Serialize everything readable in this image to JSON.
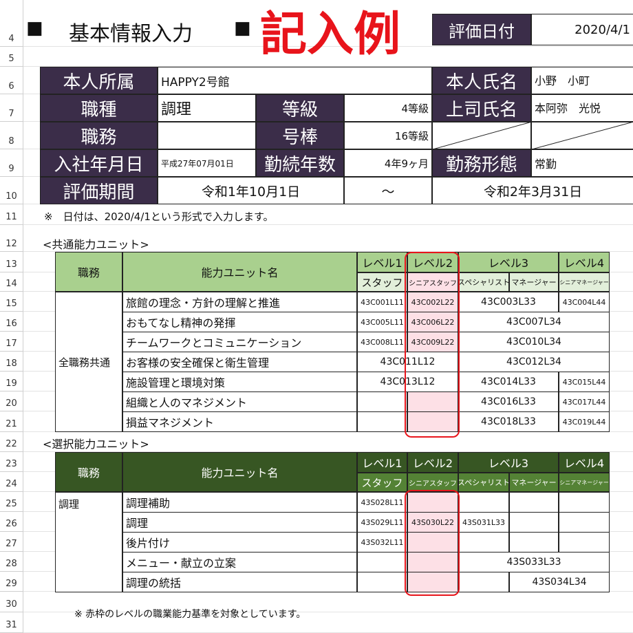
{
  "rows": [
    "4",
    "5",
    "6",
    "7",
    "8",
    "9",
    "10",
    "11",
    "12",
    "13",
    "14",
    "15",
    "16",
    "17",
    "18",
    "19",
    "20",
    "21",
    "22",
    "23",
    "24",
    "25",
    "26",
    "27",
    "28",
    "29",
    "30",
    "31"
  ],
  "heading": {
    "square1": "■",
    "title": "基本情報入力",
    "square2": "■",
    "example": "記入例"
  },
  "eval_date": {
    "label": "評価日付",
    "value": "2020/4/1"
  },
  "info": {
    "affiliation_label": "本人所属",
    "affiliation": "HAPPY2号館",
    "name_label": "本人氏名",
    "name": "小野　小町",
    "job_type_label": "職種",
    "job_type": "調理",
    "grade_label": "等級",
    "grade": "4等級",
    "boss_label": "上司氏名",
    "boss": "本阿弥　光悦",
    "duty_label": "職務",
    "duty": "",
    "number_label": "号棒",
    "number": "16等級",
    "join_label": "入社年月日",
    "join": "平成27年07月01日",
    "tenure_label": "勤続年数",
    "tenure": "4年9ヶ月",
    "work_style_label": "勤務形態",
    "work_style": "常勤",
    "period_label": "評価期間",
    "period_start": "令和1年10月1日",
    "period_sep": "～",
    "period_end": "令和2年3月31日"
  },
  "note1": "※　日付は、2020/4/1という形式で入力します。",
  "common": {
    "section": "<共通能力ユニット>",
    "col_duty": "職務",
    "col_unit": "能力ユニット名",
    "levels": [
      "レベル1",
      "レベル2",
      "レベル3",
      "レベル4"
    ],
    "roles": [
      "スタッフ",
      "シニアスタッフ",
      "スペシャリスト",
      "マネージャー",
      "シニアマネージャー"
    ],
    "group": "全職務共通",
    "units": [
      "旅館の理念・方針の理解と推進",
      "おもてなし精神の発揮",
      "チームワークとコミュニケーション",
      "お客様の安全確保と衛生管理",
      "施設管理と環境対策",
      "組織と人のマネジメント",
      "損益マネジメント"
    ],
    "codes": [
      "43C001L11",
      "43C002L22",
      "43C003L33",
      "43C004L44",
      "43C005L11",
      "43C006L22",
      "43C007L34",
      "43C008L11",
      "43C009L22",
      "43C010L34",
      "43C011L12",
      "43C012L34",
      "43C013L12",
      "43C014L33",
      "43C015L44",
      "43C016L33",
      "43C017L44",
      "43C018L33",
      "43C019L44"
    ]
  },
  "selective": {
    "section": "<選択能力ユニット>",
    "col_duty": "職務",
    "col_unit": "能力ユニット名",
    "levels": [
      "レベル1",
      "レベル2",
      "レベル3",
      "レベル4"
    ],
    "roles": [
      "スタッフ",
      "シニアスタッフ",
      "スペシャリスト",
      "マネージャー",
      "シニアマネージャー"
    ],
    "group": "調理",
    "units": [
      "調理補助",
      "調理",
      "後片付け",
      "メニュー・献立の立案",
      "調理の統括"
    ],
    "codes": [
      "43S028L11",
      "43S029L11",
      "43S030L22",
      "43S031L33",
      "43S032L11",
      "43S033L33",
      "43S034L34"
    ]
  },
  "note2": "※ 赤枠のレベルの職業能力基準を対象としています。"
}
